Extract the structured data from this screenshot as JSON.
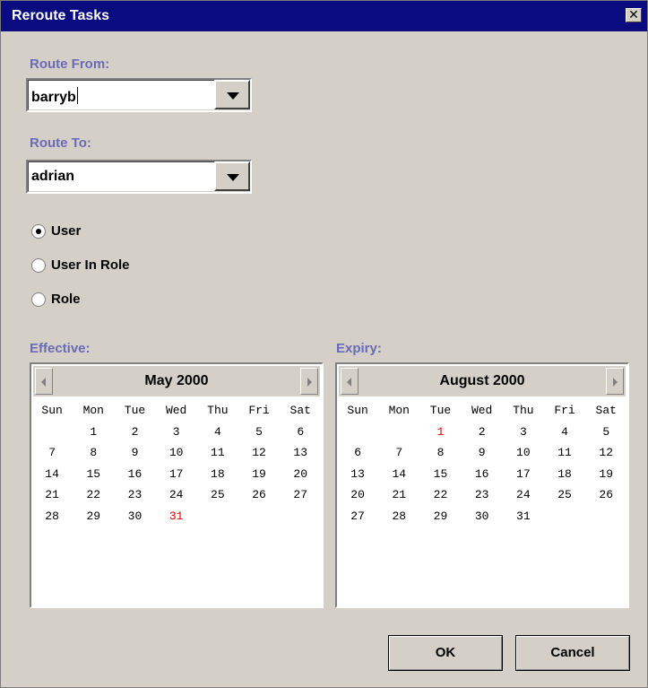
{
  "window": {
    "title": "Reroute Tasks",
    "close_symbol": "✕"
  },
  "route_from": {
    "label": "Route From:",
    "value": "barryb"
  },
  "route_to": {
    "label": "Route To:",
    "value": "adrian"
  },
  "radios": [
    {
      "label": "User",
      "checked": true
    },
    {
      "label": "User In Role",
      "checked": false
    },
    {
      "label": "Role",
      "checked": false
    }
  ],
  "effective": {
    "label": "Effective:",
    "month_title": "May 2000",
    "weekdays": [
      "Sun",
      "Mon",
      "Tue",
      "Wed",
      "Thu",
      "Fri",
      "Sat"
    ],
    "first_weekday": 1,
    "days_in_month": 31,
    "highlight_day": 31
  },
  "expiry": {
    "label": "Expiry:",
    "month_title": "August 2000",
    "weekdays": [
      "Sun",
      "Mon",
      "Tue",
      "Wed",
      "Thu",
      "Fri",
      "Sat"
    ],
    "first_weekday": 2,
    "days_in_month": 31,
    "highlight_day": 1
  },
  "buttons": {
    "ok": "OK",
    "cancel": "Cancel"
  },
  "colors": {
    "titlebar": "#0a0b7e",
    "label": "#6a6ab6",
    "highlight_day": "#e00000",
    "dialog_bg": "#d4d0c8"
  }
}
